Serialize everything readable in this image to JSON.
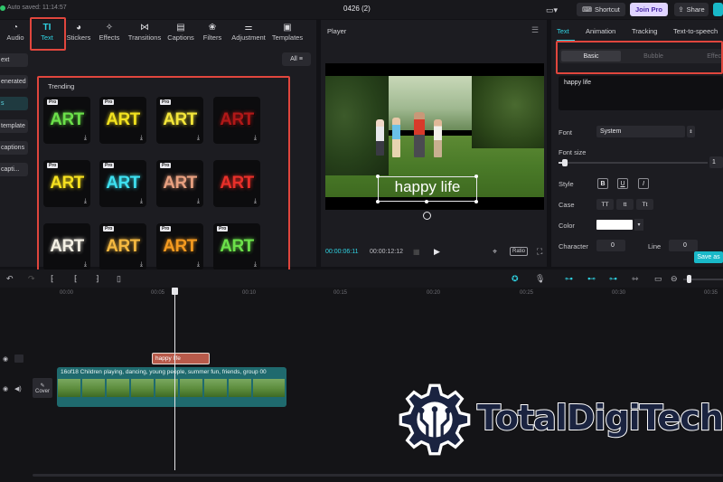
{
  "topbar": {
    "autosave": "Auto saved: 11:14:57",
    "project_title": "0426 (2)",
    "shortcut": "Shortcut",
    "join_pro": "Join Pro",
    "share": "Share"
  },
  "toolbar": {
    "tabs": [
      {
        "label": "Audio",
        "icon": "audio-icon"
      },
      {
        "label": "Text",
        "icon": "text-icon",
        "glyph": "TI"
      },
      {
        "label": "Stickers",
        "icon": "stickers-icon"
      },
      {
        "label": "Effects",
        "icon": "effects-icon"
      },
      {
        "label": "Transitions",
        "icon": "transitions-icon"
      },
      {
        "label": "Captions",
        "icon": "captions-icon"
      },
      {
        "label": "Filters",
        "icon": "filters-icon"
      },
      {
        "label": "Adjustment",
        "icon": "adjustment-icon"
      },
      {
        "label": "Templates",
        "icon": "templates-icon"
      }
    ],
    "active_tab": "Text"
  },
  "sidebar": {
    "items": [
      "ext",
      "enerated",
      "s",
      "template",
      "captions",
      "capti..."
    ]
  },
  "library": {
    "filter": "All",
    "section": "Trending",
    "presets": [
      {
        "word": "ART",
        "color": "#6be04a",
        "pro": "Pro"
      },
      {
        "word": "ART",
        "color": "#f2e21f",
        "pro": "Pro"
      },
      {
        "word": "ART",
        "color": "#f4e63a",
        "pro": "Pro"
      },
      {
        "word": "ART",
        "color": "#b01818",
        "pro": ""
      },
      {
        "word": "ART",
        "color": "#f5e020",
        "pro": "Pro"
      },
      {
        "word": "ART",
        "color": "#3ee0f0",
        "pro": "Pro"
      },
      {
        "word": "ART",
        "color": "#e8a080",
        "pro": "Pro"
      },
      {
        "word": "ART",
        "color": "#e8302a",
        "pro": ""
      },
      {
        "word": "ART",
        "color": "#f4f0e4",
        "pro": ""
      },
      {
        "word": "ART",
        "color": "#f4b840",
        "pro": "Pro"
      },
      {
        "word": "ART",
        "color": "#f49a20",
        "pro": "Pro"
      },
      {
        "word": "ART",
        "color": "#6be04a",
        "pro": "Pro"
      }
    ]
  },
  "player": {
    "title": "Player",
    "caption": "happy life",
    "time_current": "00:00:06:11",
    "time_total": "00:00:12:12",
    "ratio": "Ratio"
  },
  "inspector": {
    "tabs": [
      "Text",
      "Animation",
      "Tracking",
      "Text-to-speech"
    ],
    "active_tab": "Text",
    "modes": [
      "Basic",
      "Bubble",
      "Effect"
    ],
    "active_mode": "Basic",
    "text_value": "happy life",
    "font_label": "Font",
    "font_value": "System",
    "font_size_label": "Font size",
    "font_size_value": "1",
    "style_label": "Style",
    "style_buttons": [
      "B",
      "U",
      "I"
    ],
    "case_label": "Case",
    "case_buttons": [
      "TT",
      "tt",
      "Tt"
    ],
    "color_label": "Color",
    "color_value": "#ffffff",
    "character_label": "Character",
    "character_value": "0",
    "line_label": "Line",
    "line_value": "0",
    "save_button": "Save as"
  },
  "timeline": {
    "ruler": [
      "00:00",
      "00:05",
      "00:10",
      "00:15",
      "00:20",
      "00:25",
      "00:30",
      "00:35"
    ],
    "text_clip": "happy life",
    "video_clip": "16of18 Children playing, dancing, young people, summer fun, friends, group",
    "video_clip_duration": "00",
    "cover_label": "Cover"
  },
  "watermark": {
    "brand": "TotalDigiTech"
  },
  "colors": {
    "accent": "#2fd3e3",
    "highlight": "#e0463d",
    "pro_badge": "#e0d4ff",
    "clip_text": "#b85a4a",
    "clip_video": "#1f6a6e"
  }
}
